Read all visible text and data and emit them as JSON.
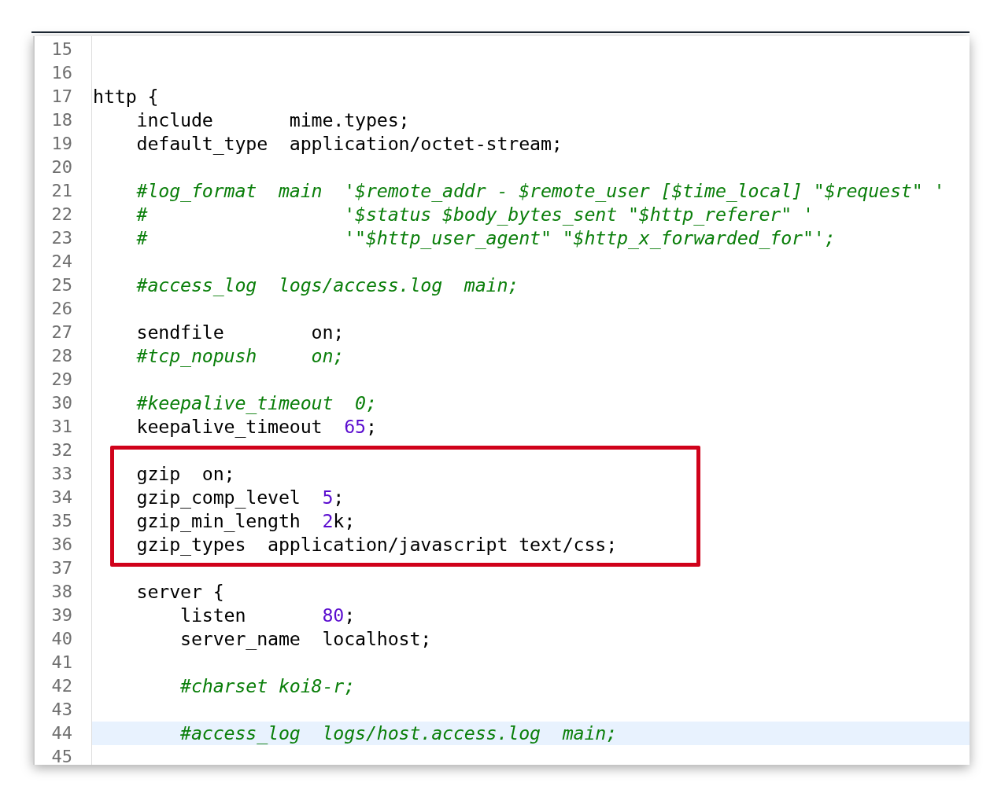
{
  "editor": {
    "lines": [
      {
        "number": "15"
      },
      {
        "number": "16"
      },
      {
        "number": "17",
        "segments": [
          {
            "kind": "plain",
            "text": "http {"
          }
        ]
      },
      {
        "number": "18",
        "segments": [
          {
            "kind": "plain",
            "text": "    include       mime.types;"
          }
        ]
      },
      {
        "number": "19",
        "segments": [
          {
            "kind": "plain",
            "text": "    default_type  application/octet-stream;"
          }
        ]
      },
      {
        "number": "20"
      },
      {
        "number": "21",
        "segments": [
          {
            "kind": "comment",
            "text": "    #log_format  main  '$remote_addr - $remote_user [$time_local] \"$request\" '"
          }
        ]
      },
      {
        "number": "22",
        "segments": [
          {
            "kind": "comment",
            "text": "    #                  '$status $body_bytes_sent \"$http_referer\" '"
          }
        ]
      },
      {
        "number": "23",
        "segments": [
          {
            "kind": "comment",
            "text": "    #                  '\"$http_user_agent\" \"$http_x_forwarded_for\"';"
          }
        ]
      },
      {
        "number": "24"
      },
      {
        "number": "25",
        "segments": [
          {
            "kind": "comment",
            "text": "    #access_log  logs/access.log  main;"
          }
        ]
      },
      {
        "number": "26"
      },
      {
        "number": "27",
        "segments": [
          {
            "kind": "plain",
            "text": "    sendfile        on;"
          }
        ]
      },
      {
        "number": "28",
        "segments": [
          {
            "kind": "comment",
            "text": "    #tcp_nopush     on;"
          }
        ]
      },
      {
        "number": "29"
      },
      {
        "number": "30",
        "segments": [
          {
            "kind": "comment",
            "text": "    #keepalive_timeout  0;"
          }
        ]
      },
      {
        "number": "31",
        "segments": [
          {
            "kind": "plain",
            "text": "    keepalive_timeout  "
          },
          {
            "kind": "number",
            "text": "65"
          },
          {
            "kind": "plain",
            "text": ";"
          }
        ]
      },
      {
        "number": "32"
      },
      {
        "number": "33",
        "boxed": true,
        "segments": [
          {
            "kind": "plain",
            "text": "    gzip  on;"
          }
        ]
      },
      {
        "number": "34",
        "boxed": true,
        "segments": [
          {
            "kind": "plain",
            "text": "    gzip_comp_level  "
          },
          {
            "kind": "number",
            "text": "5"
          },
          {
            "kind": "plain",
            "text": ";"
          }
        ]
      },
      {
        "number": "35",
        "boxed": true,
        "segments": [
          {
            "kind": "plain",
            "text": "    gzip_min_length  "
          },
          {
            "kind": "number",
            "text": "2"
          },
          {
            "kind": "plain",
            "text": "k;"
          }
        ]
      },
      {
        "number": "36",
        "boxed": true,
        "segments": [
          {
            "kind": "plain",
            "text": "    gzip_types  application/javascript text/css;"
          }
        ]
      },
      {
        "number": "37"
      },
      {
        "number": "38",
        "segments": [
          {
            "kind": "plain",
            "text": "    server {"
          }
        ]
      },
      {
        "number": "39",
        "segments": [
          {
            "kind": "plain",
            "text": "        listen       "
          },
          {
            "kind": "number",
            "text": "80"
          },
          {
            "kind": "plain",
            "text": ";"
          }
        ]
      },
      {
        "number": "40",
        "segments": [
          {
            "kind": "plain",
            "text": "        server_name  localhost;"
          }
        ]
      },
      {
        "number": "41"
      },
      {
        "number": "42",
        "segments": [
          {
            "kind": "comment",
            "text": "        #charset koi8-r;"
          }
        ]
      },
      {
        "number": "43"
      },
      {
        "number": "44",
        "current": true,
        "segments": [
          {
            "kind": "comment",
            "text": "        #access_log  logs/host.access.log  main;"
          }
        ]
      },
      {
        "number": "45"
      }
    ]
  }
}
